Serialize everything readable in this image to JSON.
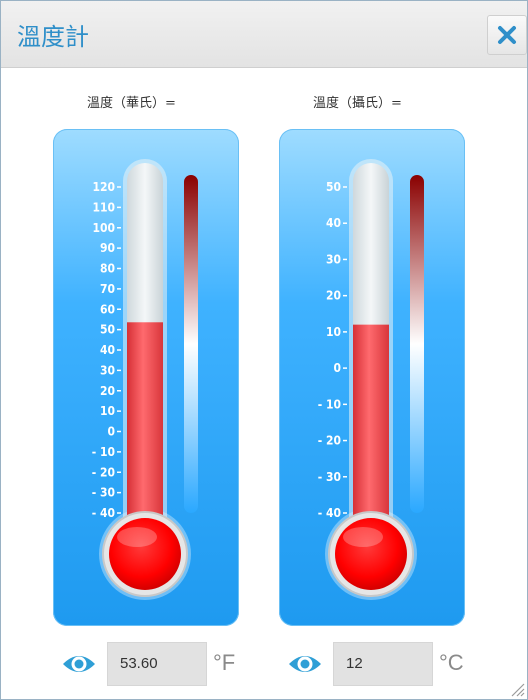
{
  "window": {
    "title": "溫度計",
    "close_icon": "close-icon"
  },
  "fahrenheit": {
    "label": "溫度（華氏）=",
    "ticks": [
      "120",
      "110",
      "100",
      "90",
      "80",
      "70",
      "60",
      "50",
      "40",
      "30",
      "20",
      "10",
      "0",
      "- 10",
      "- 20",
      "- 30",
      "- 40"
    ],
    "tick_values": [
      120,
      110,
      100,
      90,
      80,
      70,
      60,
      50,
      40,
      30,
      20,
      10,
      0,
      -10,
      -20,
      -30,
      -40
    ],
    "range": [
      -40,
      120
    ],
    "value": 53.6,
    "value_text": "53.60",
    "unit": "°F"
  },
  "celsius": {
    "label": "溫度（攝氏）=",
    "ticks": [
      "50",
      "40",
      "30",
      "20",
      "10",
      "0",
      "- 10",
      "- 20",
      "- 30",
      "- 40"
    ],
    "tick_values": [
      50,
      40,
      30,
      20,
      10,
      0,
      -10,
      -20,
      -30,
      -40
    ],
    "range": [
      -40,
      50
    ],
    "value": 12,
    "value_text": "12",
    "unit": "°C"
  },
  "colors": {
    "accent": "#2f8fc9",
    "mercury": "#f2474c",
    "bulb": "#ff1010",
    "panel": "#1e9af0"
  }
}
